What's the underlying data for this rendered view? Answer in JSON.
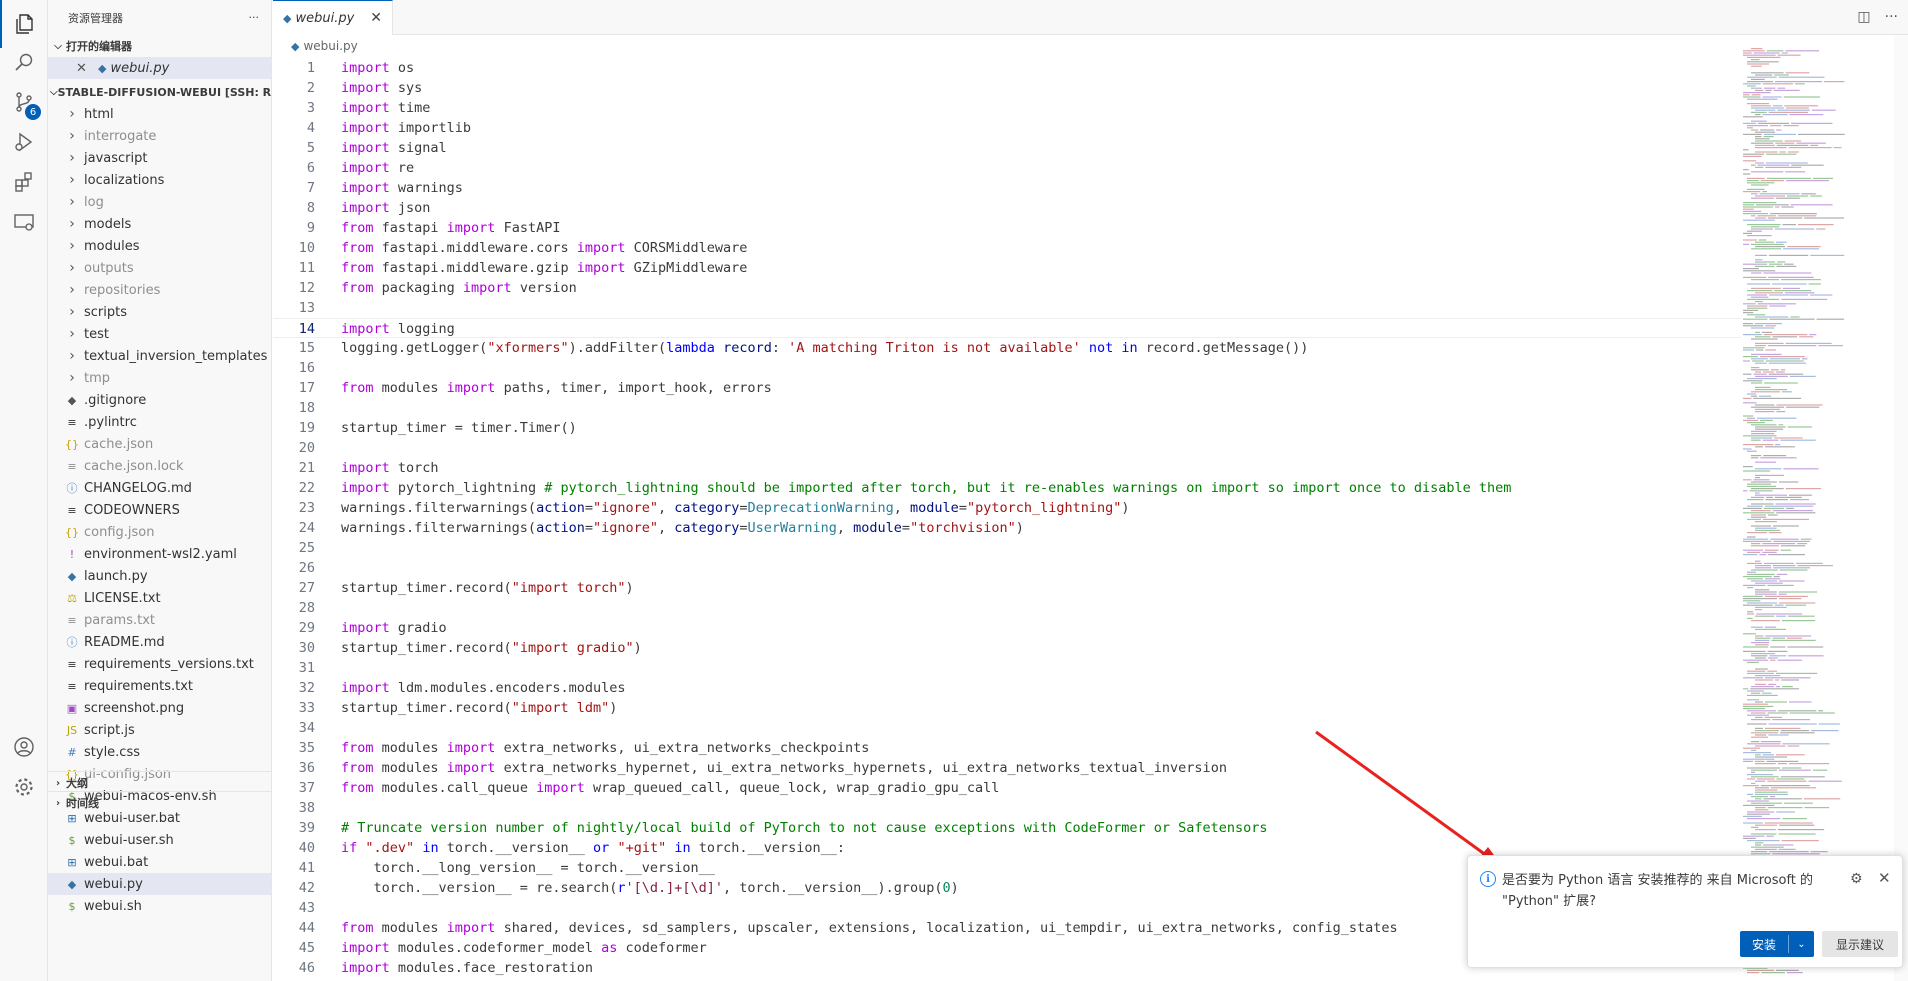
{
  "explorer": {
    "title": "资源管理器",
    "more": "···",
    "open_editors_label": "打开的编辑器",
    "open_editor_file": "webui.py",
    "workspace_label": "STABLE-DIFFUSION-WEBUI [SSH: RE...",
    "items": [
      {
        "name": "html",
        "icon": "›",
        "dim": false
      },
      {
        "name": "interrogate",
        "icon": "›",
        "dim": true
      },
      {
        "name": "javascript",
        "icon": "›",
        "dim": false
      },
      {
        "name": "localizations",
        "icon": "›",
        "dim": false
      },
      {
        "name": "log",
        "icon": "›",
        "dim": true
      },
      {
        "name": "models",
        "icon": "›",
        "dim": false
      },
      {
        "name": "modules",
        "icon": "›",
        "dim": false
      },
      {
        "name": "outputs",
        "icon": "›",
        "dim": true
      },
      {
        "name": "repositories",
        "icon": "›",
        "dim": true
      },
      {
        "name": "scripts",
        "icon": "›",
        "dim": false
      },
      {
        "name": "test",
        "icon": "›",
        "dim": false
      },
      {
        "name": "textual_inversion_templates",
        "icon": "›",
        "dim": false
      },
      {
        "name": "tmp",
        "icon": "›",
        "dim": true
      },
      {
        "name": ".gitignore",
        "icon": "◆",
        "dim": false
      },
      {
        "name": ".pylintrc",
        "icon": "≡",
        "dim": false
      },
      {
        "name": "cache.json",
        "icon": "{}",
        "dim": true
      },
      {
        "name": "cache.json.lock",
        "icon": "≡",
        "dim": true
      },
      {
        "name": "CHANGELOG.md",
        "icon": "ⓘ",
        "dim": false
      },
      {
        "name": "CODEOWNERS",
        "icon": "≡",
        "dim": false
      },
      {
        "name": "config.json",
        "icon": "{}",
        "dim": true
      },
      {
        "name": "environment-wsl2.yaml",
        "icon": "!",
        "dim": false
      },
      {
        "name": "launch.py",
        "icon": "py",
        "dim": false
      },
      {
        "name": "LICENSE.txt",
        "icon": "⚖",
        "dim": false
      },
      {
        "name": "params.txt",
        "icon": "≡",
        "dim": true
      },
      {
        "name": "README.md",
        "icon": "ⓘ",
        "dim": false
      },
      {
        "name": "requirements_versions.txt",
        "icon": "≡",
        "dim": false
      },
      {
        "name": "requirements.txt",
        "icon": "≡",
        "dim": false
      },
      {
        "name": "screenshot.png",
        "icon": "▣",
        "dim": false
      },
      {
        "name": "script.js",
        "icon": "JS",
        "dim": false
      },
      {
        "name": "style.css",
        "icon": "#",
        "dim": false
      },
      {
        "name": "ui-config.json",
        "icon": "{}",
        "dim": true
      },
      {
        "name": "webui-macos-env.sh",
        "icon": "$",
        "dim": false
      },
      {
        "name": "webui-user.bat",
        "icon": "⊞",
        "dim": false
      },
      {
        "name": "webui-user.sh",
        "icon": "$",
        "dim": false
      },
      {
        "name": "webui.bat",
        "icon": "⊞",
        "dim": false
      },
      {
        "name": "webui.py",
        "icon": "py",
        "dim": false,
        "selected": true
      },
      {
        "name": "webui.sh",
        "icon": "$",
        "dim": false
      }
    ],
    "outline_label": "大纲",
    "timeline_label": "时间线"
  },
  "activity": {
    "scm_badge": "6"
  },
  "editor": {
    "tab_label": "webui.py",
    "tab_close": "✕",
    "breadcrumb": "webui.py"
  },
  "code_lines": [
    "<span class=\"kw\">import</span> os",
    "<span class=\"kw\">import</span> sys",
    "<span class=\"kw\">import</span> time",
    "<span class=\"kw\">import</span> importlib",
    "<span class=\"kw\">import</span> signal",
    "<span class=\"kw\">import</span> re",
    "<span class=\"kw\">import</span> warnings",
    "<span class=\"kw\">import</span> json",
    "<span class=\"kw\">from</span> fastapi <span class=\"kw\">import</span> FastAPI",
    "<span class=\"kw\">from</span> fastapi.middleware.cors <span class=\"kw\">import</span> CORSMiddleware",
    "<span class=\"kw\">from</span> fastapi.middleware.gzip <span class=\"kw\">import</span> GZipMiddleware",
    "<span class=\"kw\">from</span> packaging <span class=\"kw\">import</span> version",
    "",
    "<span class=\"kw\">import</span> logging",
    "logging.getLogger(<span class=\"str\">\"xformers\"</span>).addFilter(<span class=\"kwb\">lambda</span> <span class=\"prm\">record</span>: <span class=\"str\">'A matching Triton is not available'</span> <span class=\"kwb\">not</span> <span class=\"kwb\">in</span> record.getMessage())",
    "",
    "<span class=\"kw\">from</span> modules <span class=\"kw\">import</span> paths, timer, import_hook, errors",
    "",
    "startup_timer = timer.Timer()",
    "",
    "<span class=\"kw\">import</span> torch",
    "<span class=\"kw\">import</span> pytorch_lightning <span class=\"cmt\"># pytorch_lightning should be imported after torch, but it re-enables warnings on import so import once to disable them</span>",
    "warnings.filterwarnings(<span class=\"prm\">action</span>=<span class=\"str\">\"ignore\"</span>, <span class=\"prm\">category</span>=<span class=\"cls\">DeprecationWarning</span>, <span class=\"prm\">module</span>=<span class=\"str\">\"pytorch_lightning\"</span>)",
    "warnings.filterwarnings(<span class=\"prm\">action</span>=<span class=\"str\">\"ignore\"</span>, <span class=\"prm\">category</span>=<span class=\"cls\">UserWarning</span>, <span class=\"prm\">module</span>=<span class=\"str\">\"torchvision\"</span>)",
    "",
    "",
    "startup_timer.record(<span class=\"str\">\"import torch\"</span>)",
    "",
    "<span class=\"kw\">import</span> gradio",
    "startup_timer.record(<span class=\"str\">\"import gradio\"</span>)",
    "",
    "<span class=\"kw\">import</span> ldm.modules.encoders.modules",
    "startup_timer.record(<span class=\"str\">\"import ldm\"</span>)",
    "",
    "<span class=\"kw\">from</span> modules <span class=\"kw\">import</span> extra_networks, ui_extra_networks_checkpoints",
    "<span class=\"kw\">from</span> modules <span class=\"kw\">import</span> extra_networks_hypernet, ui_extra_networks_hypernets, ui_extra_networks_textual_inversion",
    "<span class=\"kw\">from</span> modules.call_queue <span class=\"kw\">import</span> wrap_queued_call, queue_lock, wrap_gradio_gpu_call",
    "",
    "<span class=\"cmt\"># Truncate version number of nightly/local build of PyTorch to not cause exceptions with CodeFormer or Safetensors</span>",
    "<span class=\"kw\">if</span> <span class=\"str\">\".dev\"</span> <span class=\"kwb\">in</span> torch.__version__ <span class=\"kwb\">or</span> <span class=\"str\">\"+git\"</span> <span class=\"kwb\">in</span> torch.__version__:",
    "    torch.__long_version__ = torch.__version__",
    "    torch.__version__ = re.search(<span class=\"kwb\">r</span><span class=\"reg\">'[\\d.]+[\\d]'</span>, torch.__version__).group(<span class=\"num\">0</span>)",
    "",
    "<span class=\"kw\">from</span> modules <span class=\"kw\">import</span> shared, devices, sd_samplers, upscaler, extensions, localization, ui_tempdir, ui_extra_networks, config_states",
    "<span class=\"kw\">import</span> modules.codeformer_model <span class=\"kw\">as</span> codeformer",
    "<span class=\"kw\">import</span> modules.face_restoration"
  ],
  "current_line": 14,
  "notification": {
    "message": "是否要为 Python 语言 安装推荐的 来自 Microsoft 的 \"Python\" 扩展?",
    "install_label": "安装",
    "install_dropdown": "⌄",
    "show_suggestions_label": "显示建议",
    "close": "✕",
    "gear": "⚙",
    "info": "i"
  },
  "colors": {
    "accent": "#005fb8",
    "keyword": "#af00db",
    "string": "#a31515",
    "comment": "#008000",
    "arrow": "#e8221e"
  }
}
